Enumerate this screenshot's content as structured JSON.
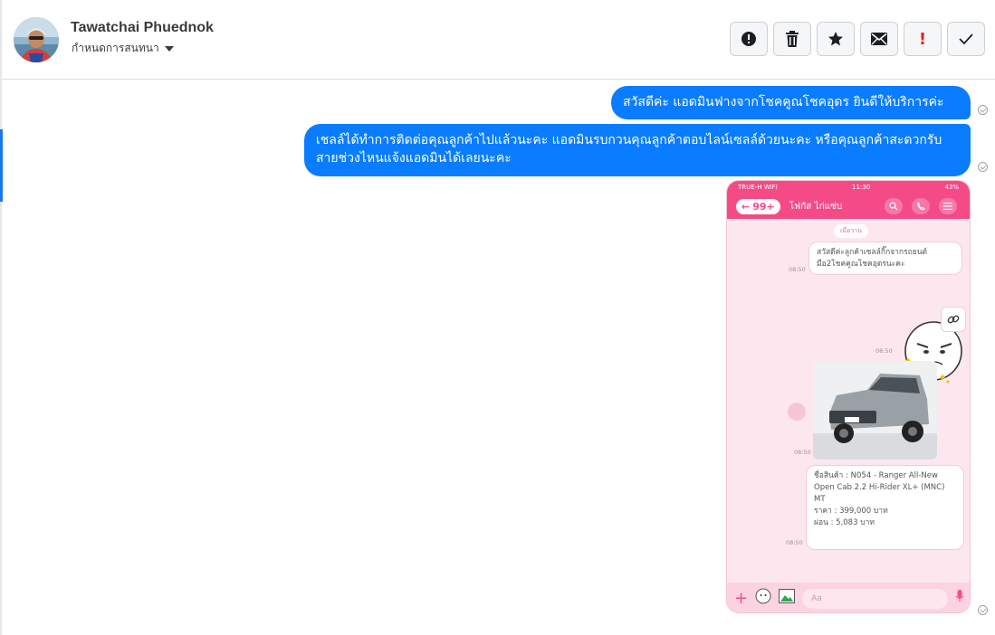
{
  "header": {
    "contact_name": "Tawatchai Phuednok",
    "conversation_status": "กำหนดการสนทนา",
    "actions": [
      {
        "name": "spam-button",
        "icon": "alert-circle-icon"
      },
      {
        "name": "delete-button",
        "icon": "trash-icon"
      },
      {
        "name": "star-button",
        "icon": "star-icon"
      },
      {
        "name": "mark-unread-button",
        "icon": "envelope-icon"
      },
      {
        "name": "mark-important-button",
        "icon": "exclamation-icon"
      },
      {
        "name": "mark-done-button",
        "icon": "checkmark-icon"
      }
    ]
  },
  "messages": [
    {
      "text": "สวัสดีค่ะ แอดมินฟางจากโชคคูณโชคอุดร ยินดีให้บริการค่ะ",
      "outgoing": true
    },
    {
      "text": "เชลล์ได้ทำการติดต่อคุณลูกค้าไปแล้วนะคะ แอดมินรบกวนคุณลูกค้าตอบไลน์เซลล์ด้วยนะคะ   หรือคุณลูกค้าสะดวกรับสายช่วงไหนแจ้งแอดมินได้เลยนะคะ",
      "outgoing": true
    }
  ],
  "attachment": {
    "status_carrier": "TRUE-H WIFI",
    "status_time": "11:30",
    "status_battery": "43%",
    "back_count": "99+",
    "chat_title": "โฟกัส ไก่แซ่บ",
    "date_chip": "เมื่อวาน",
    "bubble1": "สวัสดีค่ะลูกค้าเซลล์กิ๊กจากรถยนต์มือ2โชคคูณโชคอุดรนะคะ",
    "time1": "08:50",
    "time2": "08:50",
    "time3": "08:50",
    "time4": "08:50",
    "product_line1": "ชื่อสินค้า : N054 - Ranger All-New Open Cab 2.2 Hi-Rider XL+ (MNC) MT",
    "product_price": "ราคา : 399,000 บาท",
    "product_installment": "ผ่อน : 5,083 บาท",
    "input_placeholder": "Aa"
  }
}
